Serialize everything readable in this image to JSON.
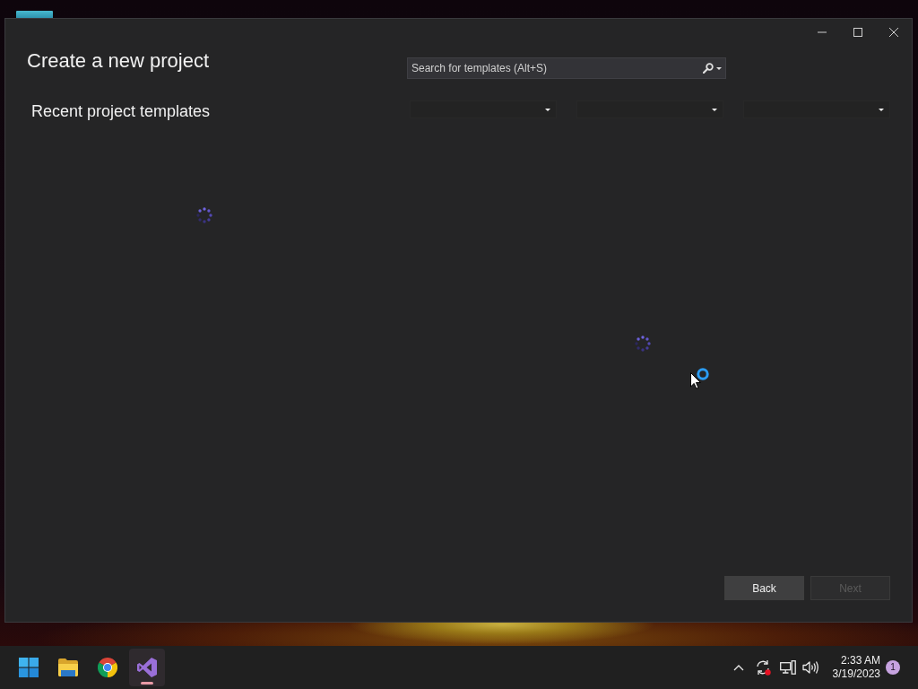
{
  "window": {
    "title": "Create a new project"
  },
  "search": {
    "placeholder": "Search for templates (Alt+S)"
  },
  "recent": {
    "heading": "Recent project templates",
    "loading": true
  },
  "filters": [
    {
      "expanded": false
    },
    {
      "expanded": false
    },
    {
      "expanded": false
    }
  ],
  "templates": {
    "loading": true
  },
  "buttons": [
    {
      "label": "Back",
      "disabled": false
    },
    {
      "label": "Next",
      "disabled": true
    }
  ],
  "cursor": {
    "busy": true
  },
  "taskbar": {
    "apps": [
      {
        "kind": "start",
        "selected": false
      },
      {
        "kind": "folder",
        "selected": false
      },
      {
        "kind": "browser",
        "selected": false
      },
      {
        "kind": "ide",
        "selected": true
      }
    ],
    "tray": {
      "time": "2:33 AM",
      "date": "3/19/2023",
      "notifications": "1"
    }
  }
}
